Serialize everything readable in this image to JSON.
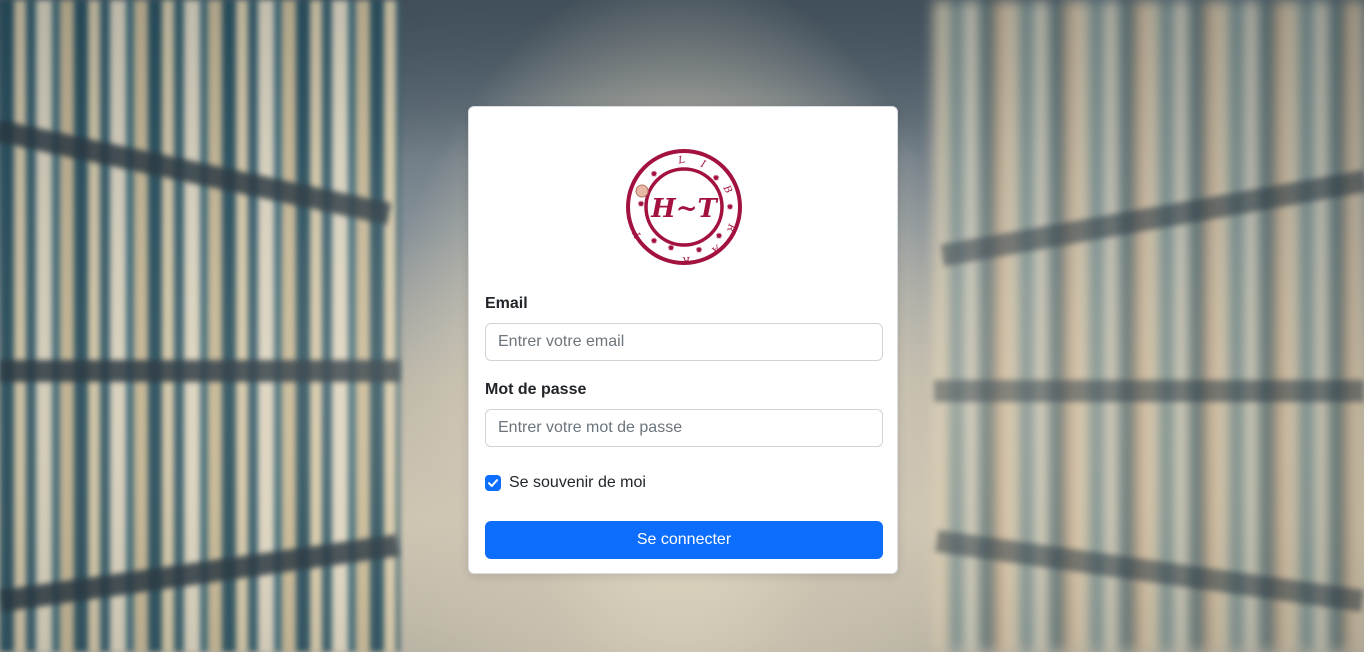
{
  "login": {
    "logo": {
      "icon": "library-logo-icon",
      "monogram": "H~T",
      "ring_letters": [
        "L",
        "I",
        "B",
        "R",
        "A",
        "R",
        "Y"
      ],
      "brand_color": "#a3123f"
    },
    "email": {
      "label": "Email",
      "placeholder": "Entrer votre email",
      "value": ""
    },
    "password": {
      "label": "Mot de passe",
      "placeholder": "Entrer votre mot de passe",
      "value": ""
    },
    "remember": {
      "label": "Se souvenir de moi",
      "checked": true,
      "icon": "checkmark-icon"
    },
    "submit_label": "Se connecter"
  },
  "colors": {
    "primary": "#0d6efd",
    "card_background": "#ffffff",
    "text": "#212529",
    "placeholder": "#6c757d"
  }
}
